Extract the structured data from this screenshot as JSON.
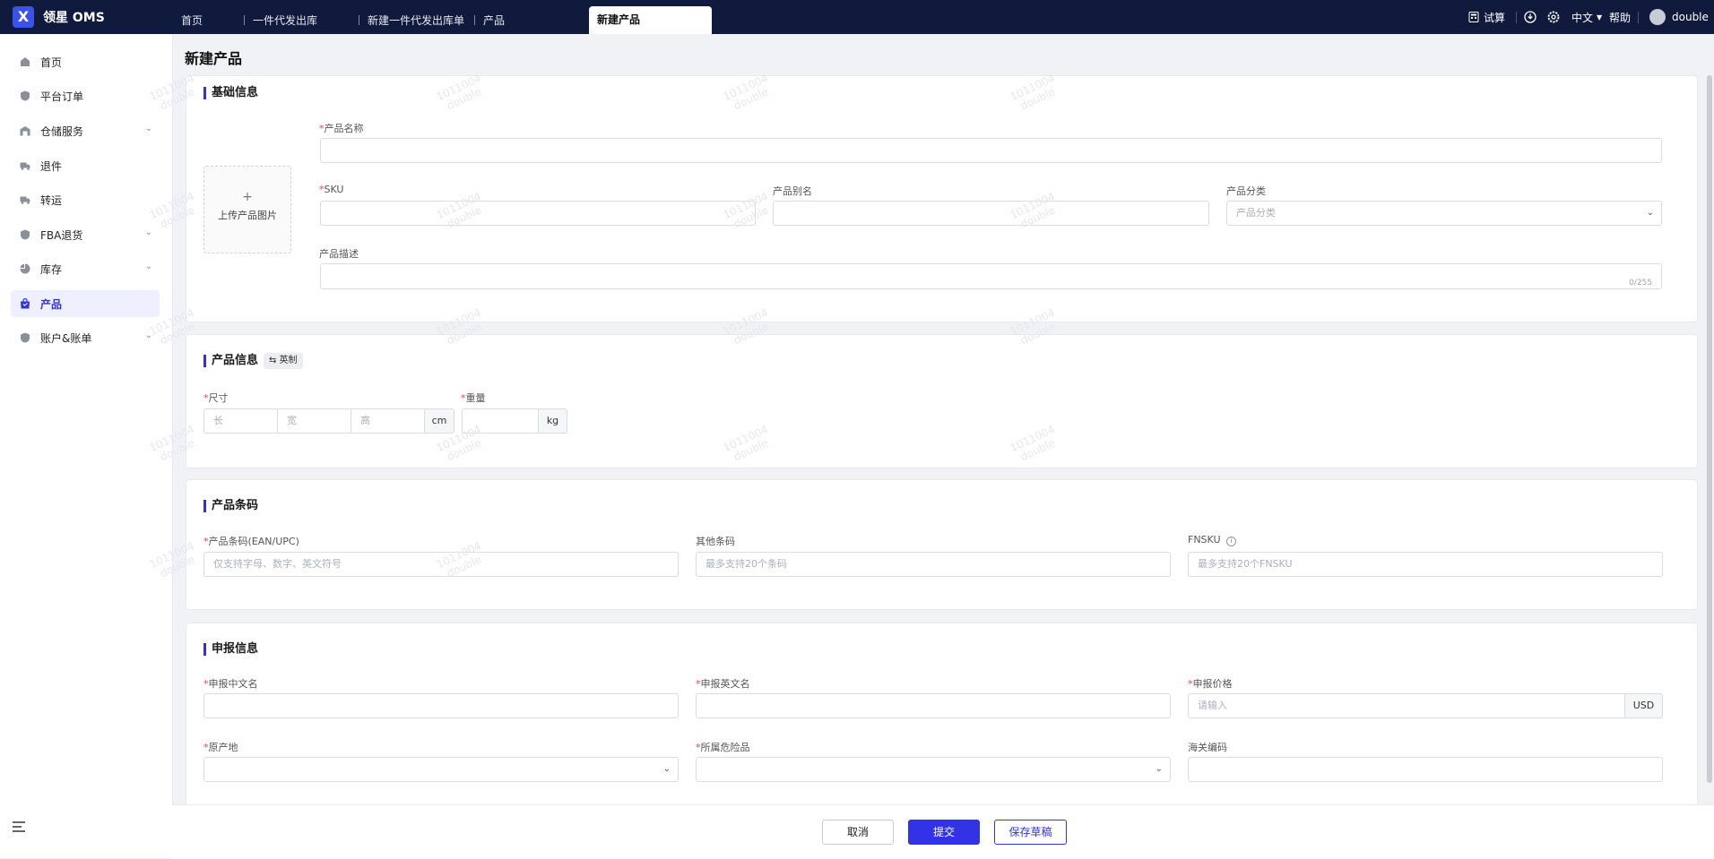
{
  "app": {
    "logo_glyph": "X",
    "name": "领星 OMS"
  },
  "tabs": [
    {
      "label": "首页"
    },
    {
      "label": "一件代发出库"
    },
    {
      "label": "新建一件代发出库单"
    },
    {
      "label": "产品"
    },
    {
      "label": "新建产品",
      "active": true
    }
  ],
  "header_right": {
    "trial": "试算",
    "language": "中文",
    "help": "帮助",
    "username": "double"
  },
  "sidebar": {
    "items": [
      {
        "label": "首页",
        "icon": "home-icon"
      },
      {
        "label": "平台订单",
        "icon": "shield-icon"
      },
      {
        "label": "仓储服务",
        "icon": "warehouse-icon",
        "expandable": true
      },
      {
        "label": "退件",
        "icon": "truck-icon"
      },
      {
        "label": "转运",
        "icon": "truck-icon"
      },
      {
        "label": "FBA退货",
        "icon": "shield-icon",
        "expandable": true
      },
      {
        "label": "库存",
        "icon": "pie-chart-icon",
        "expandable": true
      },
      {
        "label": "产品",
        "icon": "bag-icon",
        "active": true
      },
      {
        "label": "账户&账单",
        "icon": "shield-icon",
        "expandable": true
      }
    ]
  },
  "page": {
    "title": "新建产品"
  },
  "basic_info": {
    "title": "基础信息",
    "upload": {
      "plus": "+",
      "label": "上传产品图片"
    },
    "product_name": {
      "label": "产品名称",
      "value": ""
    },
    "sku": {
      "label": "SKU",
      "value": ""
    },
    "alias": {
      "label": "产品别名",
      "value": ""
    },
    "category": {
      "label": "产品分类",
      "placeholder": "产品分类"
    },
    "description": {
      "label": "产品描述",
      "counter": "0/255"
    }
  },
  "product_info": {
    "title": "产品信息",
    "unit_toggle": "⇆ 英制",
    "size": {
      "label": "尺寸",
      "length": "长",
      "width": "宽",
      "height": "高",
      "unit": "cm"
    },
    "weight": {
      "label": "重量",
      "unit": "kg"
    }
  },
  "barcode": {
    "title": "产品条码",
    "ean": {
      "label": "产品条码(EAN/UPC)",
      "placeholder": "仅支持字母、数字、英文符号"
    },
    "other": {
      "label": "其他条码",
      "placeholder": "最多支持20个条码"
    },
    "fnsku": {
      "label": "FNSKU",
      "placeholder": "最多支持20个FNSKU"
    }
  },
  "declaration": {
    "title": "申报信息",
    "cn_name": {
      "label": "申报中文名",
      "value": ""
    },
    "en_name": {
      "label": "申报英文名",
      "value": ""
    },
    "price": {
      "label": "申报价格",
      "placeholder": "请输入",
      "currency": "USD"
    },
    "origin": {
      "label": "原产地",
      "value": ""
    },
    "dangerous": {
      "label": "所属危险品",
      "value": ""
    },
    "hs_code": {
      "label": "海关编码",
      "value": ""
    }
  },
  "footer": {
    "cancel": "取消",
    "submit": "提交",
    "save_draft": "保存草稿"
  },
  "watermark": {
    "line1": "1011004",
    "line2": "double"
  },
  "colors": {
    "topbar": "#0f1a3c",
    "primary": "#3232e6",
    "required": "#e5484d"
  }
}
